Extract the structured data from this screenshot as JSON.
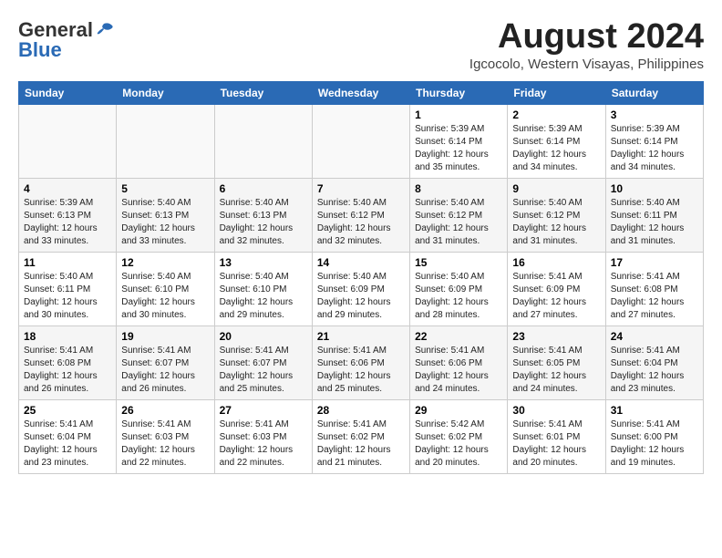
{
  "logo": {
    "general": "General",
    "blue": "Blue"
  },
  "title": {
    "month_year": "August 2024",
    "location": "Igcocolo, Western Visayas, Philippines"
  },
  "weekdays": [
    "Sunday",
    "Monday",
    "Tuesday",
    "Wednesday",
    "Thursday",
    "Friday",
    "Saturday"
  ],
  "weeks": [
    [
      {
        "day": "",
        "detail": ""
      },
      {
        "day": "",
        "detail": ""
      },
      {
        "day": "",
        "detail": ""
      },
      {
        "day": "",
        "detail": ""
      },
      {
        "day": "1",
        "detail": "Sunrise: 5:39 AM\nSunset: 6:14 PM\nDaylight: 12 hours\nand 35 minutes."
      },
      {
        "day": "2",
        "detail": "Sunrise: 5:39 AM\nSunset: 6:14 PM\nDaylight: 12 hours\nand 34 minutes."
      },
      {
        "day": "3",
        "detail": "Sunrise: 5:39 AM\nSunset: 6:14 PM\nDaylight: 12 hours\nand 34 minutes."
      }
    ],
    [
      {
        "day": "4",
        "detail": "Sunrise: 5:39 AM\nSunset: 6:13 PM\nDaylight: 12 hours\nand 33 minutes."
      },
      {
        "day": "5",
        "detail": "Sunrise: 5:40 AM\nSunset: 6:13 PM\nDaylight: 12 hours\nand 33 minutes."
      },
      {
        "day": "6",
        "detail": "Sunrise: 5:40 AM\nSunset: 6:13 PM\nDaylight: 12 hours\nand 32 minutes."
      },
      {
        "day": "7",
        "detail": "Sunrise: 5:40 AM\nSunset: 6:12 PM\nDaylight: 12 hours\nand 32 minutes."
      },
      {
        "day": "8",
        "detail": "Sunrise: 5:40 AM\nSunset: 6:12 PM\nDaylight: 12 hours\nand 31 minutes."
      },
      {
        "day": "9",
        "detail": "Sunrise: 5:40 AM\nSunset: 6:12 PM\nDaylight: 12 hours\nand 31 minutes."
      },
      {
        "day": "10",
        "detail": "Sunrise: 5:40 AM\nSunset: 6:11 PM\nDaylight: 12 hours\nand 31 minutes."
      }
    ],
    [
      {
        "day": "11",
        "detail": "Sunrise: 5:40 AM\nSunset: 6:11 PM\nDaylight: 12 hours\nand 30 minutes."
      },
      {
        "day": "12",
        "detail": "Sunrise: 5:40 AM\nSunset: 6:10 PM\nDaylight: 12 hours\nand 30 minutes."
      },
      {
        "day": "13",
        "detail": "Sunrise: 5:40 AM\nSunset: 6:10 PM\nDaylight: 12 hours\nand 29 minutes."
      },
      {
        "day": "14",
        "detail": "Sunrise: 5:40 AM\nSunset: 6:09 PM\nDaylight: 12 hours\nand 29 minutes."
      },
      {
        "day": "15",
        "detail": "Sunrise: 5:40 AM\nSunset: 6:09 PM\nDaylight: 12 hours\nand 28 minutes."
      },
      {
        "day": "16",
        "detail": "Sunrise: 5:41 AM\nSunset: 6:09 PM\nDaylight: 12 hours\nand 27 minutes."
      },
      {
        "day": "17",
        "detail": "Sunrise: 5:41 AM\nSunset: 6:08 PM\nDaylight: 12 hours\nand 27 minutes."
      }
    ],
    [
      {
        "day": "18",
        "detail": "Sunrise: 5:41 AM\nSunset: 6:08 PM\nDaylight: 12 hours\nand 26 minutes."
      },
      {
        "day": "19",
        "detail": "Sunrise: 5:41 AM\nSunset: 6:07 PM\nDaylight: 12 hours\nand 26 minutes."
      },
      {
        "day": "20",
        "detail": "Sunrise: 5:41 AM\nSunset: 6:07 PM\nDaylight: 12 hours\nand 25 minutes."
      },
      {
        "day": "21",
        "detail": "Sunrise: 5:41 AM\nSunset: 6:06 PM\nDaylight: 12 hours\nand 25 minutes."
      },
      {
        "day": "22",
        "detail": "Sunrise: 5:41 AM\nSunset: 6:06 PM\nDaylight: 12 hours\nand 24 minutes."
      },
      {
        "day": "23",
        "detail": "Sunrise: 5:41 AM\nSunset: 6:05 PM\nDaylight: 12 hours\nand 24 minutes."
      },
      {
        "day": "24",
        "detail": "Sunrise: 5:41 AM\nSunset: 6:04 PM\nDaylight: 12 hours\nand 23 minutes."
      }
    ],
    [
      {
        "day": "25",
        "detail": "Sunrise: 5:41 AM\nSunset: 6:04 PM\nDaylight: 12 hours\nand 23 minutes."
      },
      {
        "day": "26",
        "detail": "Sunrise: 5:41 AM\nSunset: 6:03 PM\nDaylight: 12 hours\nand 22 minutes."
      },
      {
        "day": "27",
        "detail": "Sunrise: 5:41 AM\nSunset: 6:03 PM\nDaylight: 12 hours\nand 22 minutes."
      },
      {
        "day": "28",
        "detail": "Sunrise: 5:41 AM\nSunset: 6:02 PM\nDaylight: 12 hours\nand 21 minutes."
      },
      {
        "day": "29",
        "detail": "Sunrise: 5:42 AM\nSunset: 6:02 PM\nDaylight: 12 hours\nand 20 minutes."
      },
      {
        "day": "30",
        "detail": "Sunrise: 5:41 AM\nSunset: 6:01 PM\nDaylight: 12 hours\nand 20 minutes."
      },
      {
        "day": "31",
        "detail": "Sunrise: 5:41 AM\nSunset: 6:00 PM\nDaylight: 12 hours\nand 19 minutes."
      }
    ]
  ]
}
